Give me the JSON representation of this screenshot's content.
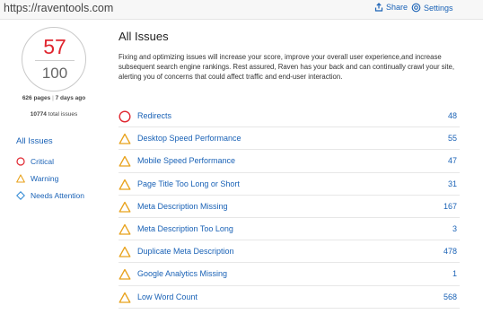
{
  "topbar": {
    "url": "https://raventools.com",
    "share_label": "Share",
    "settings_label": "Settings"
  },
  "score": {
    "value": "57",
    "total": "100",
    "pages": "626 pages",
    "separator": "|",
    "age": "7 days ago",
    "total_issues_count": "10774",
    "total_issues_label": "total issues"
  },
  "filters": {
    "title": "All Issues",
    "items": [
      {
        "label": "Critical",
        "icon": "circle-icon",
        "color": "#e0262f"
      },
      {
        "label": "Warning",
        "icon": "triangle-icon",
        "color": "#e8a21c"
      },
      {
        "label": "Needs Attention",
        "icon": "diamond-icon",
        "color": "#3b8fd6"
      }
    ]
  },
  "main": {
    "title": "All Issues",
    "intro": "Fixing and optimizing issues will increase your score, improve your overall user experience,and increase subsequent search engine rankings. Rest assured, Raven has your back and can continually crawl your site, alerting you of concerns that could affect traffic and end-user interaction.",
    "issues": [
      {
        "label": "Redirects",
        "count": "48",
        "severity": "critical"
      },
      {
        "label": "Desktop Speed Performance",
        "count": "55",
        "severity": "warning"
      },
      {
        "label": "Mobile Speed Performance",
        "count": "47",
        "severity": "warning"
      },
      {
        "label": "Page Title Too Long or Short",
        "count": "31",
        "severity": "warning"
      },
      {
        "label": "Meta Description Missing",
        "count": "167",
        "severity": "warning"
      },
      {
        "label": "Meta Description Too Long",
        "count": "3",
        "severity": "warning"
      },
      {
        "label": "Duplicate Meta Description",
        "count": "478",
        "severity": "warning"
      },
      {
        "label": "Google Analytics Missing",
        "count": "1",
        "severity": "warning"
      },
      {
        "label": "Low Word Count",
        "count": "568",
        "severity": "warning"
      }
    ]
  },
  "colors": {
    "link": "#1a62b6",
    "critical": "#e0262f",
    "warning": "#e8a21c",
    "attention": "#3b8fd6"
  }
}
